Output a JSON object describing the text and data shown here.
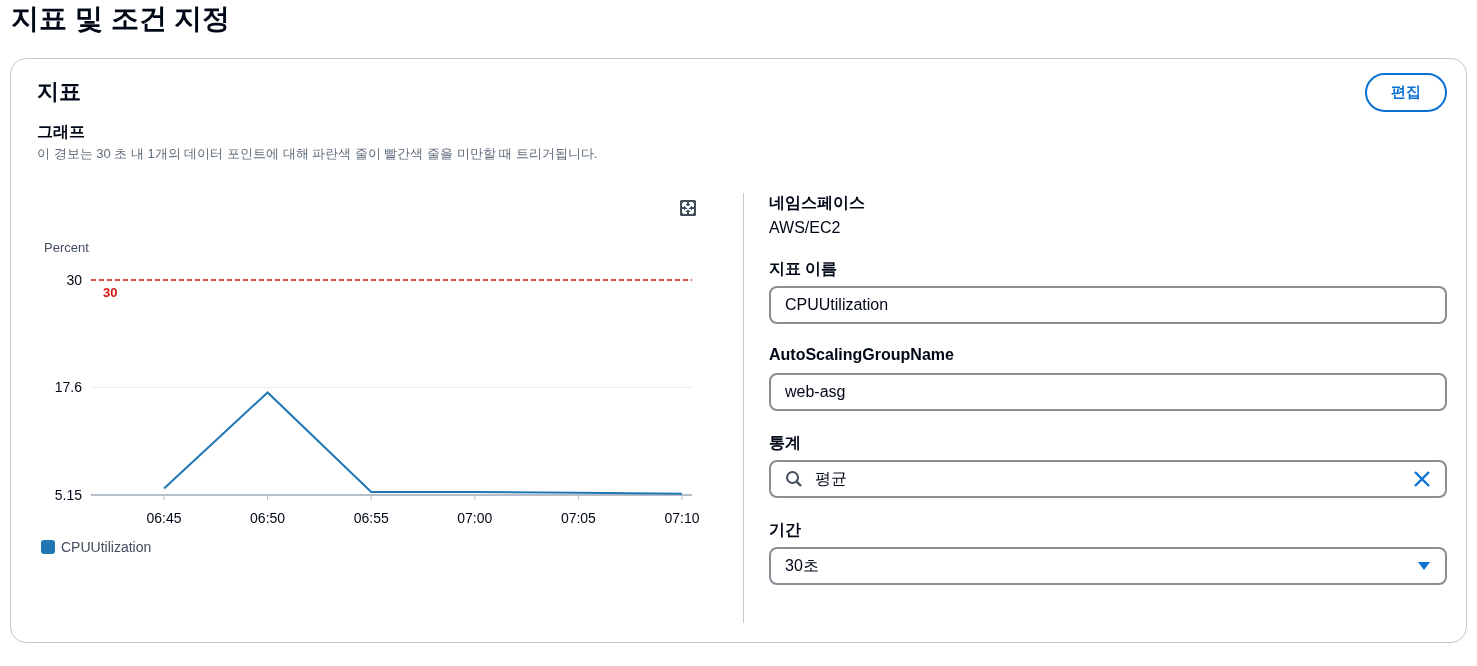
{
  "page_title": "지표 및 조건 지정",
  "panel": {
    "title": "지표",
    "edit_button": "편집",
    "graph": {
      "title": "그래프",
      "description": "이 경보는 30 초 내 1개의 데이터 포인트에 대해 파란색 줄이 빨간색 줄을 미만할 때 트리거됩니다.",
      "chart_data": {
        "type": "line",
        "ylabel": "Percent",
        "categories": [
          "06:45",
          "06:50",
          "06:55",
          "07:00",
          "07:05",
          "07:10"
        ],
        "series": [
          {
            "name": "CPUUtilization",
            "color": "#1f77b4",
            "values": [
              5.9,
              17.0,
              5.5,
              5.5,
              5.4,
              5.3
            ]
          }
        ],
        "ylim": [
          5.15,
          30
        ],
        "yticks": [
          5.15,
          17.6,
          30
        ],
        "ref_lines": [
          {
            "label": "30",
            "color": "#d91515"
          }
        ]
      }
    },
    "fields": [
      {
        "kind": "text",
        "label": "네임스페이스",
        "value": "AWS/EC2"
      },
      {
        "kind": "input",
        "label": "지표 이름",
        "value": "CPUUtilization"
      },
      {
        "kind": "input",
        "label": "AutoScalingGroupName",
        "value": "web-asg"
      },
      {
        "kind": "search",
        "label": "통계",
        "value": "평균"
      },
      {
        "kind": "select",
        "label": "기간",
        "value": "30초"
      }
    ]
  }
}
